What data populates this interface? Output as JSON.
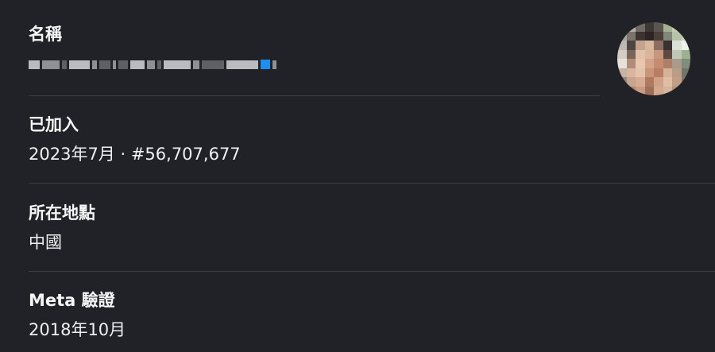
{
  "profile": {
    "name_label": "名稱",
    "name_value_redacted": true,
    "joined_label": "已加入",
    "joined_value": "2023年7月 · #56,707,677",
    "location_label": "所在地點",
    "location_value": "中國",
    "meta_label": "Meta 驗證",
    "meta_value": "2018年10月"
  },
  "colors": {
    "background": "#202227",
    "divider": "#3b3e45",
    "text": "#f2f3f5",
    "verified_badge": "#1f8ef1"
  },
  "icons": {
    "verified_badge": "verified-badge-icon",
    "avatar": "profile-avatar"
  }
}
